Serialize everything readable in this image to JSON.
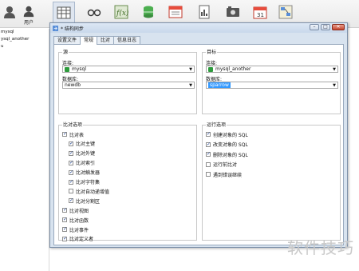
{
  "toolbar": {
    "items": [
      {
        "icon": "table-icon",
        "label": ""
      },
      {
        "icon": "glasses-icon",
        "label": ""
      },
      {
        "icon": "function-icon",
        "label": ""
      },
      {
        "icon": "database-icon",
        "label": ""
      },
      {
        "icon": "form-icon",
        "label": ""
      },
      {
        "icon": "report-icon",
        "label": ""
      },
      {
        "icon": "backup-icon",
        "label": ""
      },
      {
        "icon": "schedule-icon",
        "label": ""
      },
      {
        "icon": "model-icon",
        "label": ""
      }
    ],
    "user_label": "用户"
  },
  "sidebar": {
    "items": [
      "mysql",
      "ysql_another",
      "u"
    ]
  },
  "window": {
    "title": "* 结构同步",
    "tabs": [
      "设置文件",
      "常规",
      "比对",
      "信息日志"
    ],
    "active_tab": 1
  },
  "source": {
    "title": "源",
    "connection_label": "连接:",
    "connection_value": "mysql",
    "database_label": "数据库:",
    "database_value": "newdb"
  },
  "target": {
    "title": "目标",
    "connection_label": "连接:",
    "connection_value": "mysql_another",
    "database_label": "数据库:",
    "database_value": "sparrow"
  },
  "compare_options": {
    "title": "比对选项",
    "items": [
      {
        "label": "比对表",
        "checked": true,
        "indent": 0
      },
      {
        "label": "比对主键",
        "checked": true,
        "indent": 1
      },
      {
        "label": "比对外键",
        "checked": true,
        "indent": 1
      },
      {
        "label": "比对索引",
        "checked": true,
        "indent": 1
      },
      {
        "label": "比对触发器",
        "checked": true,
        "indent": 1
      },
      {
        "label": "比对字符集",
        "checked": true,
        "indent": 1
      },
      {
        "label": "比对自动递增值",
        "checked": false,
        "indent": 1
      },
      {
        "label": "比对分割区",
        "checked": true,
        "indent": 1
      },
      {
        "label": "比对视图",
        "checked": true,
        "indent": 0
      },
      {
        "label": "比对函数",
        "checked": true,
        "indent": 0
      },
      {
        "label": "比对事件",
        "checked": true,
        "indent": 0
      },
      {
        "label": "比对定义者",
        "checked": true,
        "indent": 0
      }
    ]
  },
  "run_options": {
    "title": "运行选项",
    "items": [
      {
        "label": "创建对象的 SQL",
        "checked": true
      },
      {
        "label": "改变对象的 SQL",
        "checked": true
      },
      {
        "label": "删除对象的 SQL",
        "checked": true
      },
      {
        "label": "运行前比对",
        "checked": false
      },
      {
        "label": "遇到错误继续",
        "checked": false
      }
    ]
  },
  "watermark": "软件技巧",
  "colors": {
    "accent": "#3399ff",
    "window_frame": "#d8e3ef",
    "connection_icon": "#2e9b3d"
  }
}
